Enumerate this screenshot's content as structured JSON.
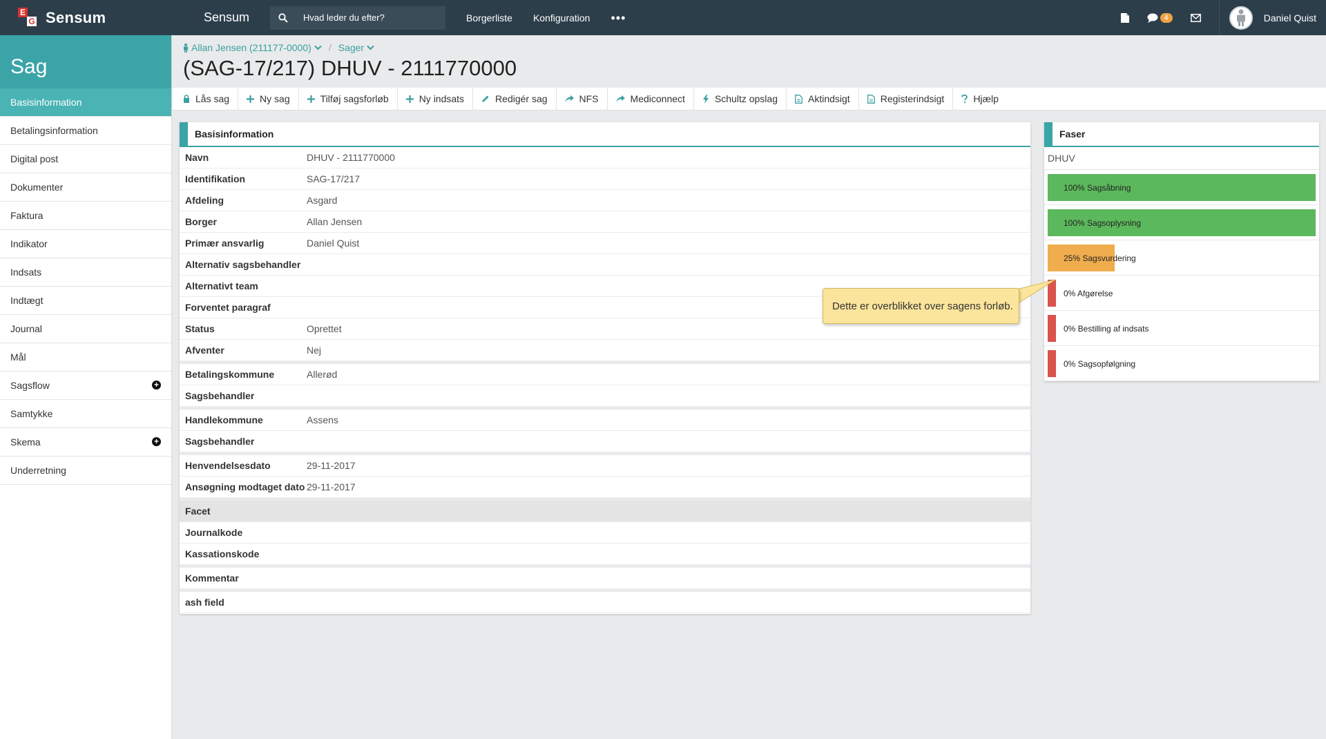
{
  "topbar": {
    "brand": "Sensum",
    "logo_letters": [
      "E",
      "G"
    ],
    "app_title": "Sensum",
    "search_placeholder": "Hvad leder du efter?",
    "nav": [
      "Borgerliste",
      "Konfiguration"
    ],
    "more": "•••",
    "messages_count": "4",
    "user_name": "Daniel Quist"
  },
  "sidebar": {
    "title": "Sag",
    "items": [
      {
        "label": "Basisinformation",
        "active": true
      },
      {
        "label": "Betalingsinformation"
      },
      {
        "label": "Digital post"
      },
      {
        "label": "Dokumenter"
      },
      {
        "label": "Faktura"
      },
      {
        "label": "Indikator"
      },
      {
        "label": "Indsats"
      },
      {
        "label": "Indtægt"
      },
      {
        "label": "Journal"
      },
      {
        "label": "Mål"
      },
      {
        "label": "Sagsflow",
        "expandable": true
      },
      {
        "label": "Samtykke"
      },
      {
        "label": "Skema",
        "expandable": true
      },
      {
        "label": "Underretning"
      }
    ]
  },
  "breadcrumb": {
    "person": "Allan Jensen (211177-0000)",
    "separator": "/",
    "section": "Sager"
  },
  "page_title": "(SAG-17/217) DHUV - 2111770000",
  "toolbar": [
    {
      "label": "Lås sag",
      "icon": "lock-icon"
    },
    {
      "label": "Ny sag",
      "icon": "plus-icon"
    },
    {
      "label": "Tilføj sagsforløb",
      "icon": "plus-icon"
    },
    {
      "label": "Ny indsats",
      "icon": "plus-icon"
    },
    {
      "label": "Redigér sag",
      "icon": "pencil-icon"
    },
    {
      "label": "NFS",
      "icon": "share-icon"
    },
    {
      "label": "Mediconnect",
      "icon": "share-icon"
    },
    {
      "label": "Schultz opslag",
      "icon": "lightning-icon"
    },
    {
      "label": "Aktindsigt",
      "icon": "document-icon"
    },
    {
      "label": "Registerindsigt",
      "icon": "document-icon"
    },
    {
      "label": "Hjælp",
      "icon": "question-icon"
    }
  ],
  "basis": {
    "title": "Basisinformation",
    "groups": [
      [
        {
          "label": "Navn",
          "value": "DHUV - 2111770000"
        },
        {
          "label": "Identifikation",
          "value": "SAG-17/217"
        },
        {
          "label": "Afdeling",
          "value": "Asgard"
        },
        {
          "label": "Borger",
          "value": "Allan Jensen"
        },
        {
          "label": "Primær ansvarlig",
          "value": "Daniel Quist"
        },
        {
          "label": "Alternativ sagsbehandler",
          "value": ""
        },
        {
          "label": "Alternativt team",
          "value": ""
        },
        {
          "label": "Forventet paragraf",
          "value": ""
        },
        {
          "label": "Status",
          "value": "Oprettet"
        },
        {
          "label": "Afventer",
          "value": "Nej"
        }
      ],
      [
        {
          "label": "Betalingskommune",
          "value": "Allerød"
        },
        {
          "label": "Sagsbehandler",
          "value": ""
        }
      ],
      [
        {
          "label": "Handlekommune",
          "value": "Assens"
        },
        {
          "label": "Sagsbehandler",
          "value": ""
        }
      ],
      [
        {
          "label": "Henvendelsesdato",
          "value": "29-11-2017"
        },
        {
          "label": "Ansøgning modtaget dato",
          "value": "29-11-2017"
        }
      ],
      [
        {
          "label": "Facet",
          "value": "",
          "shaded": true
        },
        {
          "label": "Journalkode",
          "value": ""
        },
        {
          "label": "Kassationskode",
          "value": ""
        }
      ],
      [
        {
          "label": "Kommentar",
          "value": ""
        }
      ],
      [
        {
          "label": "ash field",
          "value": ""
        }
      ]
    ]
  },
  "faser": {
    "title": "Faser",
    "subtitle": "DHUV",
    "phases": [
      {
        "label": "100% Sagsåbning",
        "percent": 100
      },
      {
        "label": "100% Sagsoplysning",
        "percent": 100
      },
      {
        "label": "25% Sagsvurdering",
        "percent": 25
      },
      {
        "label": "0% Afgørelse",
        "percent": 0
      },
      {
        "label": "0% Bestilling af indsats",
        "percent": 0
      },
      {
        "label": "0% Sagsopfølgning",
        "percent": 0
      }
    ],
    "colors": {
      "complete": "#5cb85c",
      "partial": "#f0ad4e",
      "none": "#d9534f"
    }
  },
  "tooltip": {
    "text": "Dette er overblikket over sagens forløb."
  }
}
